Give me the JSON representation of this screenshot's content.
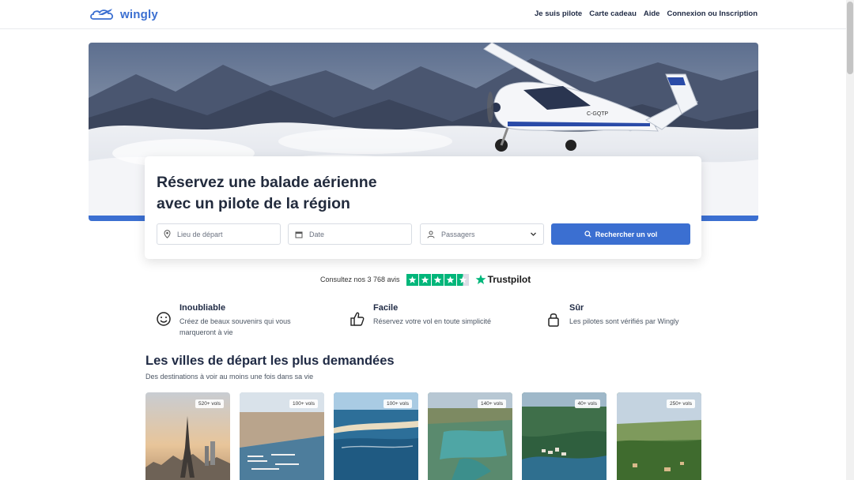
{
  "header": {
    "logo_text": "wingly",
    "nav": [
      {
        "label": "Je suis pilote"
      },
      {
        "label": "Carte cadeau"
      },
      {
        "label": "Aide"
      },
      {
        "label": "Connexion ou Inscription"
      }
    ]
  },
  "hero": {
    "plane_registration": "C-GQTP"
  },
  "search": {
    "title_line1": "Réservez une balade aérienne",
    "title_line2": "avec un pilote de la région",
    "departure_placeholder": "Lieu de départ",
    "date_placeholder": "Date",
    "passengers_value": "Passagers",
    "button_label": "Rechercher un vol"
  },
  "trustpilot": {
    "text": "Consultez nos 3 768 avis",
    "rating_stars": 4.5,
    "brand": "Trustpilot"
  },
  "features": [
    {
      "icon": "smile-icon",
      "title": "Inoubliable",
      "description": "Créez de beaux souvenirs qui vous marqueront à vie"
    },
    {
      "icon": "thumbs-up-icon",
      "title": "Facile",
      "description": "Réservez votre vol en toute simplicité"
    },
    {
      "icon": "lock-icon",
      "title": "Sûr",
      "description": "Les pilotes sont vérifiés par Wingly"
    }
  ],
  "cities": {
    "title": "Les villes de départ les plus demandées",
    "subtitle": "Des destinations à voir au moins une fois dans sa vie",
    "cards": [
      {
        "badge": "520+ vols"
      },
      {
        "badge": "100+ vols"
      },
      {
        "badge": "100+ vols"
      },
      {
        "badge": "140+ vols"
      },
      {
        "badge": "40+ vols"
      },
      {
        "badge": "250+ vols"
      }
    ]
  },
  "colors": {
    "brand_blue": "#3b6fd1",
    "trustpilot_green": "#00b67a",
    "text_dark": "#1f2a44"
  }
}
